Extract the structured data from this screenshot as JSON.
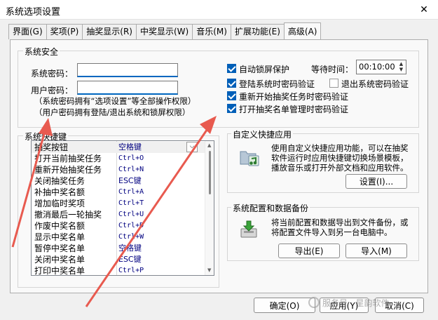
{
  "window": {
    "title": "系统选项设置",
    "close": "✕"
  },
  "tabs": [
    "界面(G)",
    "奖项(P)",
    "抽奖显示(R)",
    "中奖显示(W)",
    "音乐(M)",
    "扩展功能(E)",
    "高级(A)"
  ],
  "security": {
    "group_label": "系统安全",
    "system_pwd_label": "系统密码：",
    "user_pwd_label": "用户密码：",
    "note1": "（系统密码拥有“选项设置”等全部操作权限）",
    "note2": "（用户密码拥有登陆/退出系统和锁屏权限）",
    "auto_lock": "自动锁屏保护",
    "wait_label": "等待时间：",
    "wait_value": "00:10:00",
    "login_verify": "登陆系统时密码验证",
    "logout_verify": "退出系统密码验证",
    "restart_verify": "重新开始抽奖任务时密码验证",
    "list_mgmt_verify": "打开抽奖名单管理时密码验证"
  },
  "hotkeys": {
    "group_label": "系统快捷键",
    "rows": [
      [
        "抽奖按钮",
        "空格键"
      ],
      [
        "打开当前抽奖任务",
        "Ctrl+O"
      ],
      [
        "重新开始抽奖任务",
        "Ctrl+N"
      ],
      [
        "关闭抽奖任务",
        "ESC键"
      ],
      [
        "补抽中奖名额",
        "Ctrl+A"
      ],
      [
        "增加临时奖项",
        "Ctrl+T"
      ],
      [
        "撤消最后一轮抽奖",
        "Ctrl+U"
      ],
      [
        "作废中奖名额",
        "Ctrl+D"
      ],
      [
        "显示中奖名单",
        "Ctrl+W"
      ],
      [
        "暂停中奖名单",
        "空格键"
      ],
      [
        "关闭中奖名单",
        "ESC键"
      ],
      [
        "打印中奖名单",
        "Ctrl+P"
      ]
    ]
  },
  "custom_app": {
    "group_label": "自定义快捷应用",
    "desc": "使用自定义快捷应用功能，可以在抽奖软件运行时应用快捷键切换场景模板，播放音乐或打开外部文档和应用软件。",
    "settings_button": "设置(I)..."
  },
  "backup": {
    "group_label": "系统配置和数据备份",
    "desc": "将当前配置和数据导出到文件备份，或将配置文件导入到另一台电脑中。",
    "export_button": "导出(E)",
    "import_button": "导入(M)"
  },
  "footer": {
    "ok_button": "确定(O)",
    "apply_button": "应用(Y)",
    "cancel_button": "取消(C)",
    "watermark": "服务号 · 星韵软件"
  },
  "colors": {
    "accent": "#005fb8",
    "arrow": "#e85a4f",
    "hotkey_text": "#000080"
  }
}
